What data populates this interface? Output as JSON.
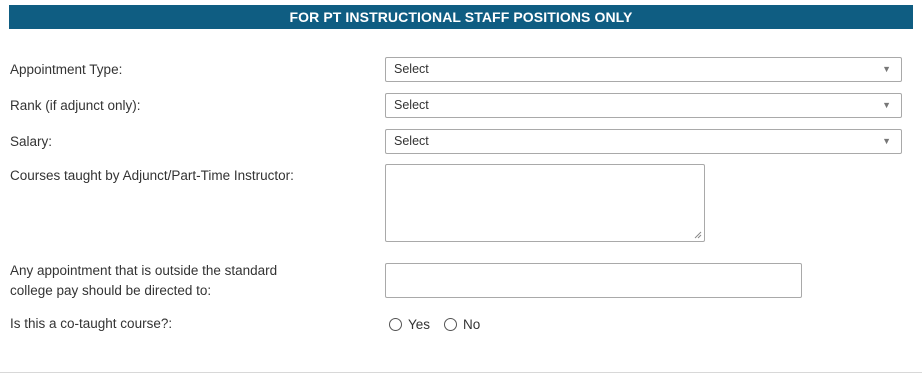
{
  "section": {
    "title": "FOR PT INSTRUCTIONAL STAFF POSITIONS ONLY"
  },
  "fields": {
    "appointment_type": {
      "label": "Appointment Type:",
      "value": "Select"
    },
    "rank": {
      "label": "Rank (if adjunct only):",
      "value": "Select"
    },
    "salary": {
      "label": "Salary:",
      "value": "Select"
    },
    "courses": {
      "label": "Courses taught by Adjunct/Part-Time Instructor:",
      "value": ""
    },
    "outside_pay": {
      "label_line1": "Any appointment that is outside the standard",
      "label_line2": "college pay should be directed to:",
      "value": ""
    },
    "co_taught": {
      "label": "Is this a co-taught course?:",
      "options": [
        "Yes",
        "No"
      ]
    }
  },
  "icons": {
    "dropdown_arrow": "▼"
  },
  "colors": {
    "banner": "#0f5d82",
    "border": "#a9a9a9"
  }
}
